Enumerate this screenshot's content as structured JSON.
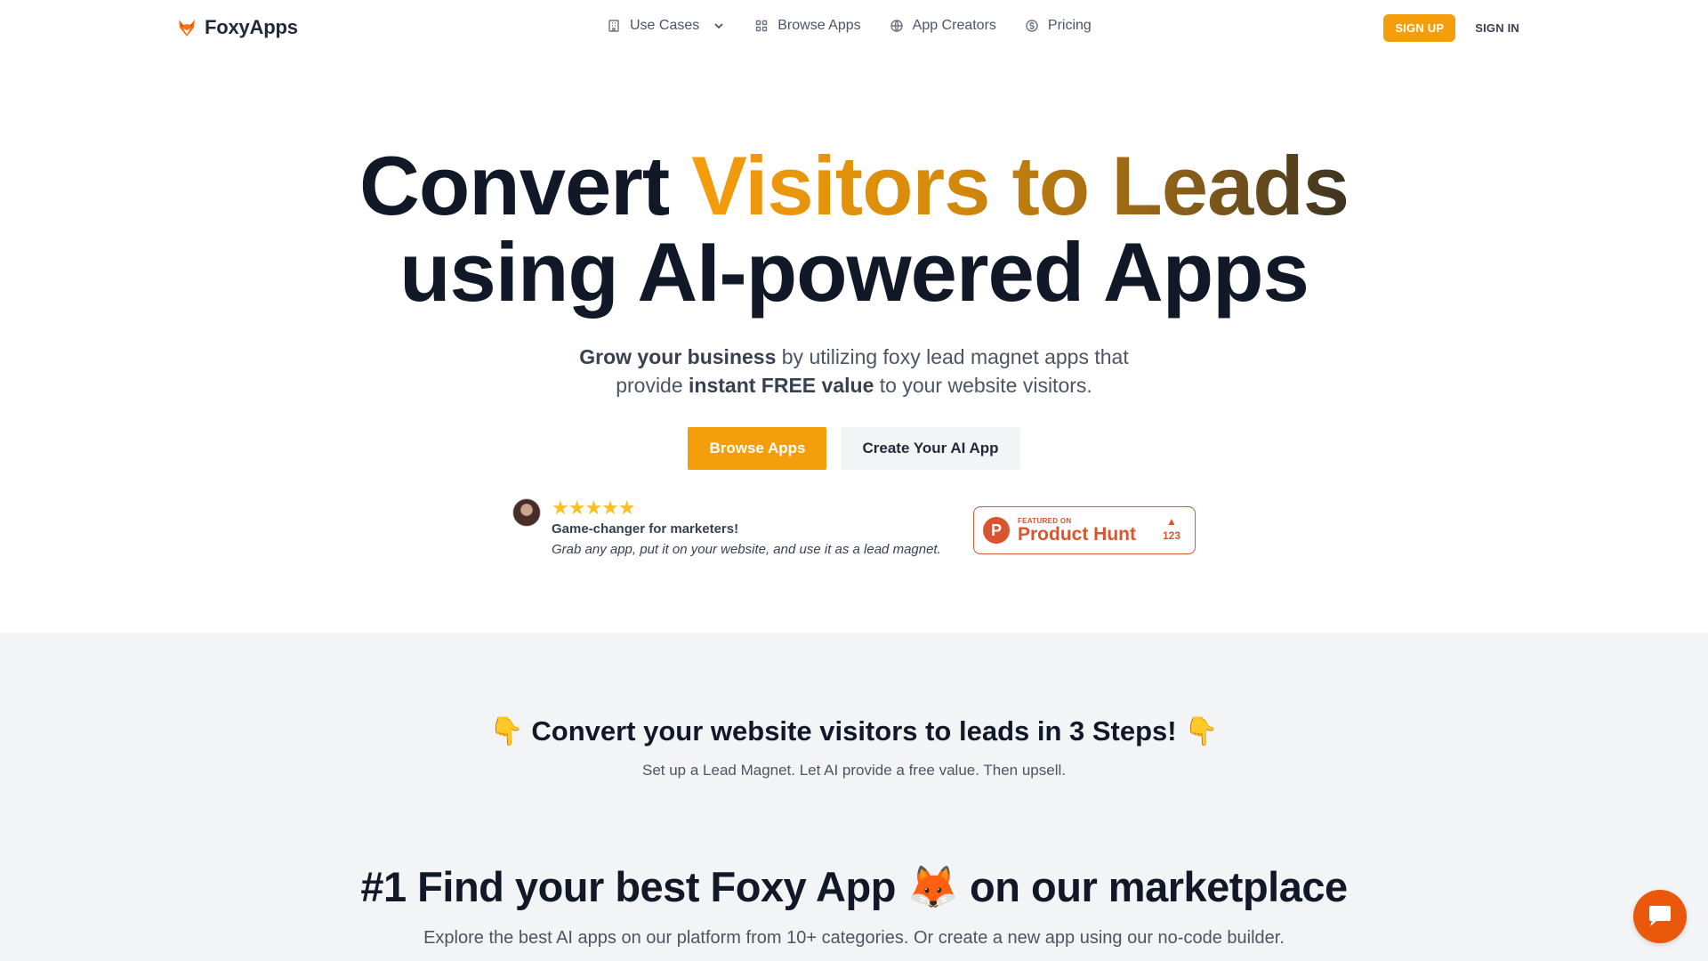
{
  "nav": {
    "brand": "FoxyApps",
    "links": [
      {
        "label": "Use Cases",
        "icon": "building-icon"
      },
      {
        "label": "Browse Apps",
        "icon": "grid-icon"
      },
      {
        "label": "App Creators",
        "icon": "globe-icon"
      },
      {
        "label": "Pricing",
        "icon": "dollar-icon"
      }
    ],
    "signup_label": "SIGN UP",
    "signin_label": "SIGN IN"
  },
  "hero": {
    "title_part1": "Convert ",
    "title_highlight": "Visitors to Leads",
    "title_line2": "using AI-powered Apps",
    "sub_bold1": "Grow your business",
    "sub_text1": " by utilizing foxy lead magnet apps that",
    "sub_text2": "provide ",
    "sub_bold2": "instant FREE value",
    "sub_text3": " to your website visitors.",
    "primary_button": "Browse Apps",
    "secondary_button": "Create Your AI App"
  },
  "review": {
    "stars": "★★★★★",
    "rating": 5,
    "title": "Game-changer for marketers!",
    "text": "Grab any app, put it on your website, and use it as a lead magnet."
  },
  "product_hunt": {
    "logo_letter": "P",
    "featured_label": "FEATURED ON",
    "name": "Product Hunt",
    "arrow": "▲",
    "votes": "123"
  },
  "steps": {
    "emoji": "👇",
    "title": "Convert your website visitors to leads in 3 Steps!",
    "subtitle": "Set up a Lead Magnet. Let AI provide a free value. Then upsell."
  },
  "marketplace": {
    "title_part1": "#1 Find your best Foxy App ",
    "emoji": "🦊",
    "title_part2": " on our marketplace",
    "subtitle": "Explore the best AI apps on our platform from 10+ categories. Or create a new app using our no-code builder."
  },
  "colors": {
    "accent": "#f59e0b",
    "product_hunt": "#da552f",
    "chat": "#ea580c",
    "section_bg": "#f3f4f6"
  }
}
